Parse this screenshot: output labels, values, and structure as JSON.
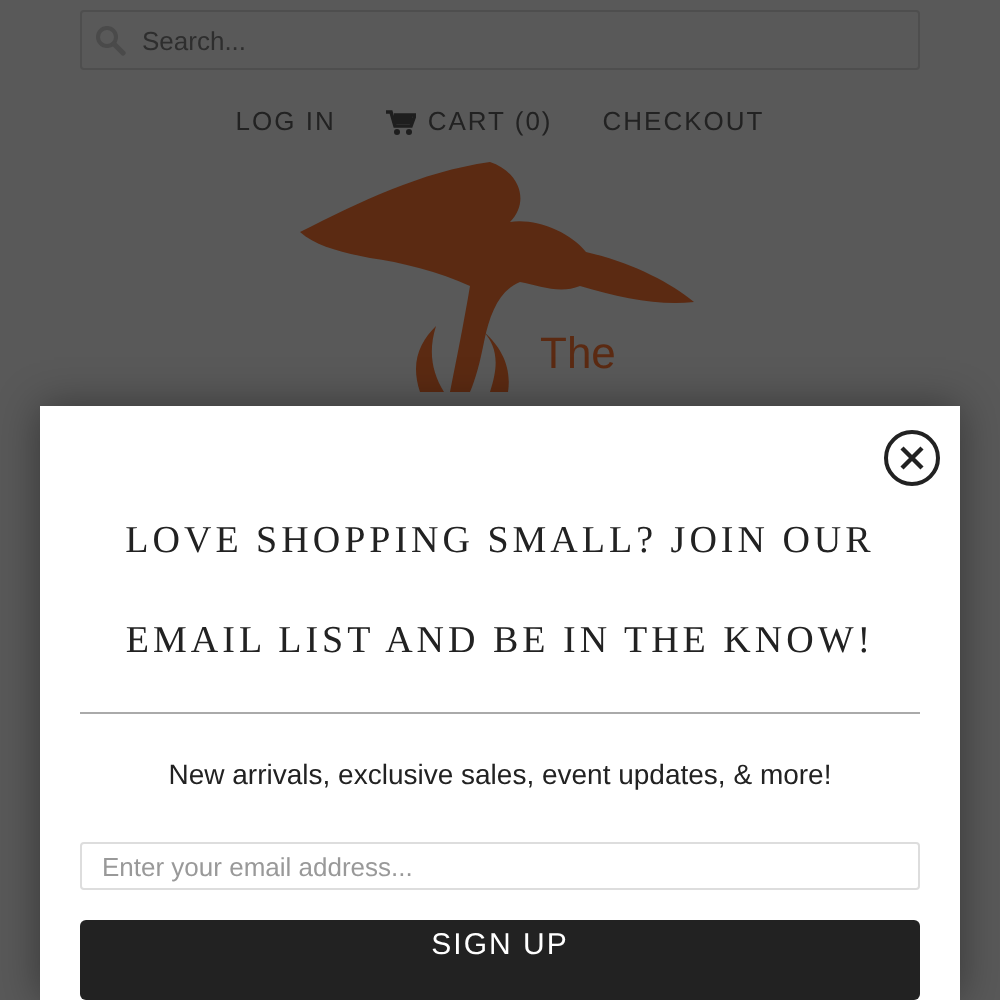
{
  "search": {
    "placeholder": "Search..."
  },
  "nav": [
    {
      "label": "LOG IN",
      "kind": "link"
    },
    {
      "label": "CART (0)",
      "kind": "cart"
    },
    {
      "label": "CHECKOUT",
      "kind": "link"
    }
  ],
  "logo": {
    "text": "The"
  },
  "popup": {
    "heading_lines": [
      "LOVE SHOPPING SMALL? JOIN OUR",
      "EMAIL LIST AND BE IN THE KNOW!"
    ],
    "subtext": "New arrivals, exclusive sales, event updates, & more!",
    "email": {
      "placeholder": "Enter your email address..."
    },
    "button": "SIGN UP"
  }
}
